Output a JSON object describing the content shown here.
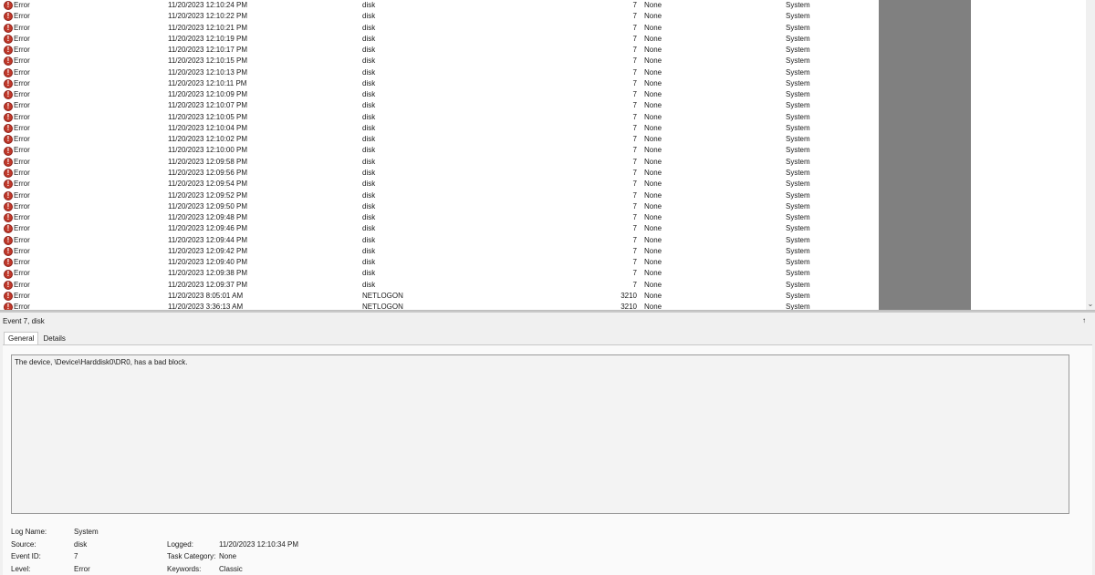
{
  "events": {
    "level_label": "Error",
    "rows": [
      {
        "date": "11/20/2023 12:10:24 PM",
        "source": "disk",
        "id": "7",
        "task": "None",
        "log": "System"
      },
      {
        "date": "11/20/2023 12:10:22 PM",
        "source": "disk",
        "id": "7",
        "task": "None",
        "log": "System"
      },
      {
        "date": "11/20/2023 12:10:21 PM",
        "source": "disk",
        "id": "7",
        "task": "None",
        "log": "System"
      },
      {
        "date": "11/20/2023 12:10:19 PM",
        "source": "disk",
        "id": "7",
        "task": "None",
        "log": "System"
      },
      {
        "date": "11/20/2023 12:10:17 PM",
        "source": "disk",
        "id": "7",
        "task": "None",
        "log": "System"
      },
      {
        "date": "11/20/2023 12:10:15 PM",
        "source": "disk",
        "id": "7",
        "task": "None",
        "log": "System"
      },
      {
        "date": "11/20/2023 12:10:13 PM",
        "source": "disk",
        "id": "7",
        "task": "None",
        "log": "System"
      },
      {
        "date": "11/20/2023 12:10:11 PM",
        "source": "disk",
        "id": "7",
        "task": "None",
        "log": "System"
      },
      {
        "date": "11/20/2023 12:10:09 PM",
        "source": "disk",
        "id": "7",
        "task": "None",
        "log": "System"
      },
      {
        "date": "11/20/2023 12:10:07 PM",
        "source": "disk",
        "id": "7",
        "task": "None",
        "log": "System"
      },
      {
        "date": "11/20/2023 12:10:05 PM",
        "source": "disk",
        "id": "7",
        "task": "None",
        "log": "System"
      },
      {
        "date": "11/20/2023 12:10:04 PM",
        "source": "disk",
        "id": "7",
        "task": "None",
        "log": "System"
      },
      {
        "date": "11/20/2023 12:10:02 PM",
        "source": "disk",
        "id": "7",
        "task": "None",
        "log": "System"
      },
      {
        "date": "11/20/2023 12:10:00 PM",
        "source": "disk",
        "id": "7",
        "task": "None",
        "log": "System"
      },
      {
        "date": "11/20/2023 12:09:58 PM",
        "source": "disk",
        "id": "7",
        "task": "None",
        "log": "System"
      },
      {
        "date": "11/20/2023 12:09:56 PM",
        "source": "disk",
        "id": "7",
        "task": "None",
        "log": "System"
      },
      {
        "date": "11/20/2023 12:09:54 PM",
        "source": "disk",
        "id": "7",
        "task": "None",
        "log": "System"
      },
      {
        "date": "11/20/2023 12:09:52 PM",
        "source": "disk",
        "id": "7",
        "task": "None",
        "log": "System"
      },
      {
        "date": "11/20/2023 12:09:50 PM",
        "source": "disk",
        "id": "7",
        "task": "None",
        "log": "System"
      },
      {
        "date": "11/20/2023 12:09:48 PM",
        "source": "disk",
        "id": "7",
        "task": "None",
        "log": "System"
      },
      {
        "date": "11/20/2023 12:09:46 PM",
        "source": "disk",
        "id": "7",
        "task": "None",
        "log": "System"
      },
      {
        "date": "11/20/2023 12:09:44 PM",
        "source": "disk",
        "id": "7",
        "task": "None",
        "log": "System"
      },
      {
        "date": "11/20/2023 12:09:42 PM",
        "source": "disk",
        "id": "7",
        "task": "None",
        "log": "System"
      },
      {
        "date": "11/20/2023 12:09:40 PM",
        "source": "disk",
        "id": "7",
        "task": "None",
        "log": "System"
      },
      {
        "date": "11/20/2023 12:09:38 PM",
        "source": "disk",
        "id": "7",
        "task": "None",
        "log": "System"
      },
      {
        "date": "11/20/2023 12:09:37 PM",
        "source": "disk",
        "id": "7",
        "task": "None",
        "log": "System"
      },
      {
        "date": "11/20/2023 8:05:01 AM",
        "source": "NETLOGON",
        "id": "3210",
        "task": "None",
        "log": "System"
      },
      {
        "date": "11/20/2023 3:36:13 AM",
        "source": "NETLOGON",
        "id": "3210",
        "task": "None",
        "log": "System"
      }
    ]
  },
  "details": {
    "title": "Event 7, disk",
    "close_glyph": "↑",
    "tabs": [
      "General",
      "Details"
    ],
    "message": "The device, \\Device\\Harddisk0\\DR0, has a bad block.",
    "log_name_label": "Log Name:",
    "log_name_value": "System",
    "source_label": "Source:",
    "source_value": "disk",
    "event_id_label": "Event ID:",
    "event_id_value": "7",
    "level_label": "Level:",
    "level_value": "Error",
    "logged_label": "Logged:",
    "logged_value": "11/20/2023 12:10:34 PM",
    "task_category_label": "Task Category:",
    "task_category_value": "None",
    "keywords_label": "Keywords:",
    "keywords_value": "Classic"
  },
  "icons": {
    "error_icon_glyph": "!",
    "scroll_down_glyph": "⌄"
  },
  "colors": {
    "error_icon": "#c0392b",
    "grey_column": "#808080"
  }
}
